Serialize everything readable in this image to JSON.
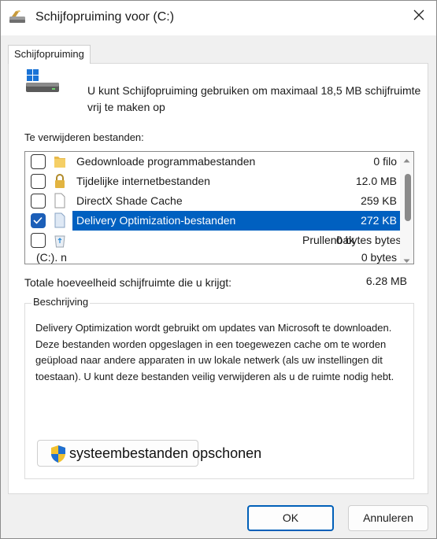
{
  "window": {
    "title": "Schijfopruiming voor (C:)",
    "tab_label": "Schijfopruiming",
    "drive_icon": "windows-drive-icon",
    "title_icon": "disk-cleanup-icon"
  },
  "intro": {
    "line1": "U kunt Schijfopruiming gebruiken om maximaal 18,5 MB schijfruimte",
    "line2": "vrij te maken op"
  },
  "files_section": {
    "label": "Te verwijderen bestanden:",
    "items": [
      {
        "checked": false,
        "icon": "folder-icon",
        "name": "Gedownloade programmabestanden",
        "size": "0 filo"
      },
      {
        "checked": false,
        "icon": "lock-icon",
        "name": "Tijdelijke internetbestanden",
        "size": "12.0 MB"
      },
      {
        "checked": false,
        "icon": "document-icon",
        "name": "DirectX Shade Cache",
        "size": "259 KB"
      },
      {
        "checked": true,
        "icon": "document-icon",
        "name": "Delivery Optimization-bestanden",
        "size": "272 KB"
      },
      {
        "checked": false,
        "icon": "recycle-bin-icon",
        "name": "Prullenbak",
        "size": "0 bytes bytes"
      },
      {
        "checked": false,
        "icon": "",
        "name": "(C:). n",
        "size": "0 bytes"
      }
    ]
  },
  "total": {
    "label": "Totale hoeveelheid schijfruimte die u krijgt:",
    "value": "6.28 MB"
  },
  "description": {
    "legend": "Beschrijving",
    "text": "Delivery Optimization wordt gebruikt om updates van Microsoft te downloaden. Deze bestanden worden opgeslagen in een toegewezen cache om te worden geüpload naar andere apparaten in uw lokale netwerk (als uw instellingen dit toestaan). U kunt deze bestanden veilig verwijderen als u de ruimte nodig hebt."
  },
  "cleanup_button": {
    "label": "systeembestanden opschonen",
    "icon": "uac-shield-icon"
  },
  "buttons": {
    "ok": "OK",
    "cancel": "Annuleren"
  },
  "colors": {
    "selection": "#0060c0",
    "accent": "#005fb8"
  }
}
